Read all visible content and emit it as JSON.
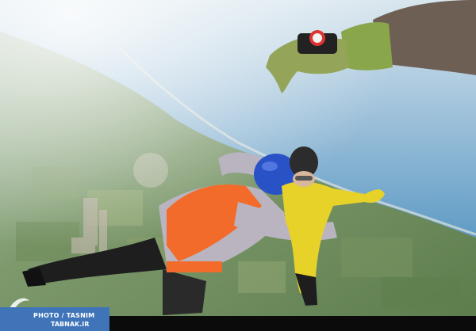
{
  "scene": {
    "subject": "tandem skydiving over coastline",
    "colors": {
      "sky_top": "#c7d9e6",
      "sea": "#2f7fb5",
      "land": "#6f8a5e",
      "harness": "#f26b2a",
      "suit_yellow": "#e7d22a",
      "helmet_blue": "#2a52c7"
    }
  },
  "watermark": {
    "line1": "PHOTO / TASNIM",
    "line2": "TABNAK.IR",
    "background": "#3f74b9"
  }
}
